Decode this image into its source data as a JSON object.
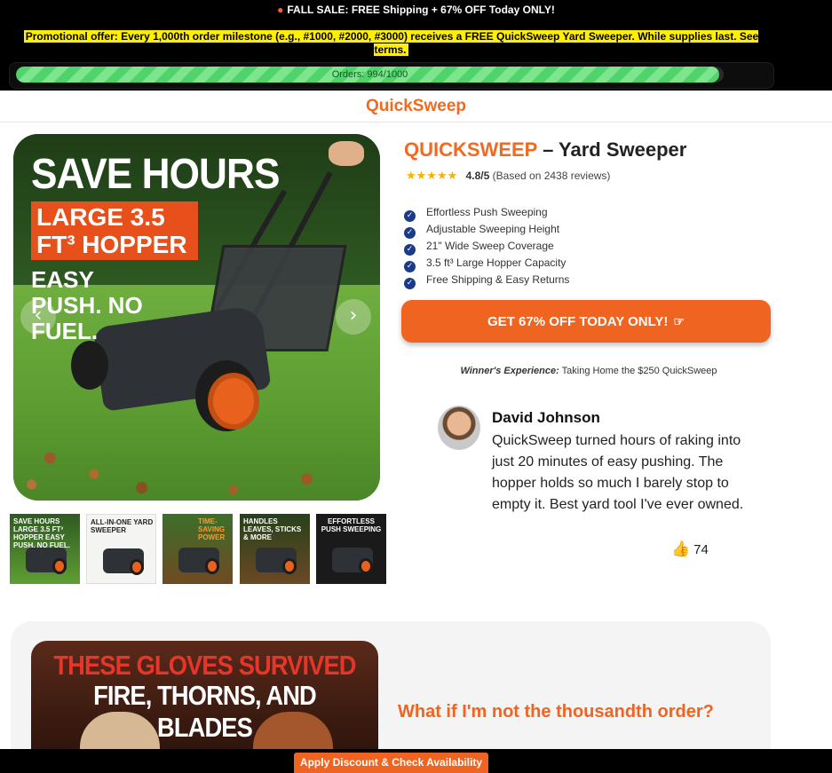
{
  "promo": {
    "icon": "fire-icon",
    "title": "FALL SALE: FREE Shipping + 67% OFF Today ONLY!",
    "offer": "Promotional offer: Every 1,000th order milestone (e.g., #1000, #2000, #3000) receives a FREE QuickSweep Yard Sweeper. While supplies last. See terms.",
    "orders_text": "Orders: 994/1000",
    "progress_fraction": 0.994
  },
  "header": {
    "logo": "QuickSweep"
  },
  "gallery": {
    "hero_line1": "SAVE HOURS",
    "hero_line2": "LARGE 3.5 FT³ HOPPER",
    "hero_line3": "EASY PUSH. NO FUEL.",
    "prev_arrow": "‹",
    "next_arrow": "›",
    "thumbs": [
      {
        "label": "SAVE HOURS LARGE 3.5 FT³ HOPPER EASY PUSH. NO FUEL."
      },
      {
        "label": "ALL-IN-ONE YARD SWEEPER"
      },
      {
        "label": "TIME-SAVING POWER"
      },
      {
        "label": "HANDLES LEAVES, STICKS & MORE"
      },
      {
        "label": "EFFORTLESS PUSH SWEEPING"
      }
    ]
  },
  "product": {
    "brand": "QUICKSWEEP",
    "title_rest": " – Yard Sweeper",
    "stars": "★★★★★",
    "rating": "4.8/5",
    "reviews": "(Based on 2438 reviews)",
    "features": [
      "Effortless Push Sweeping",
      "Adjustable Sweeping Height",
      "21\" Wide Sweep Coverage",
      "3.5 ft³ Large Hopper Capacity",
      "Free Shipping & Easy Returns"
    ],
    "cta": "GET 67% OFF TODAY ONLY!",
    "winner_label": "Winner's Experience:",
    "winner_text": " Taking Home the $250 QuickSweep"
  },
  "review": {
    "name": "David Johnson",
    "text": "QuickSweep turned hours of raking into just 20 minutes of easy pushing. The hopper holds so much I barely stop to empty it. Best yard tool I've ever owned.",
    "likes": "74"
  },
  "lower": {
    "gloves_line1": "THESE GLOVES SURVIVED",
    "gloves_line2": "FIRE, THORNS, AND BLADES",
    "faq_question": "What if I'm not the thousandth order?"
  },
  "sticky": {
    "button": "Apply Discount & Check Availability"
  }
}
